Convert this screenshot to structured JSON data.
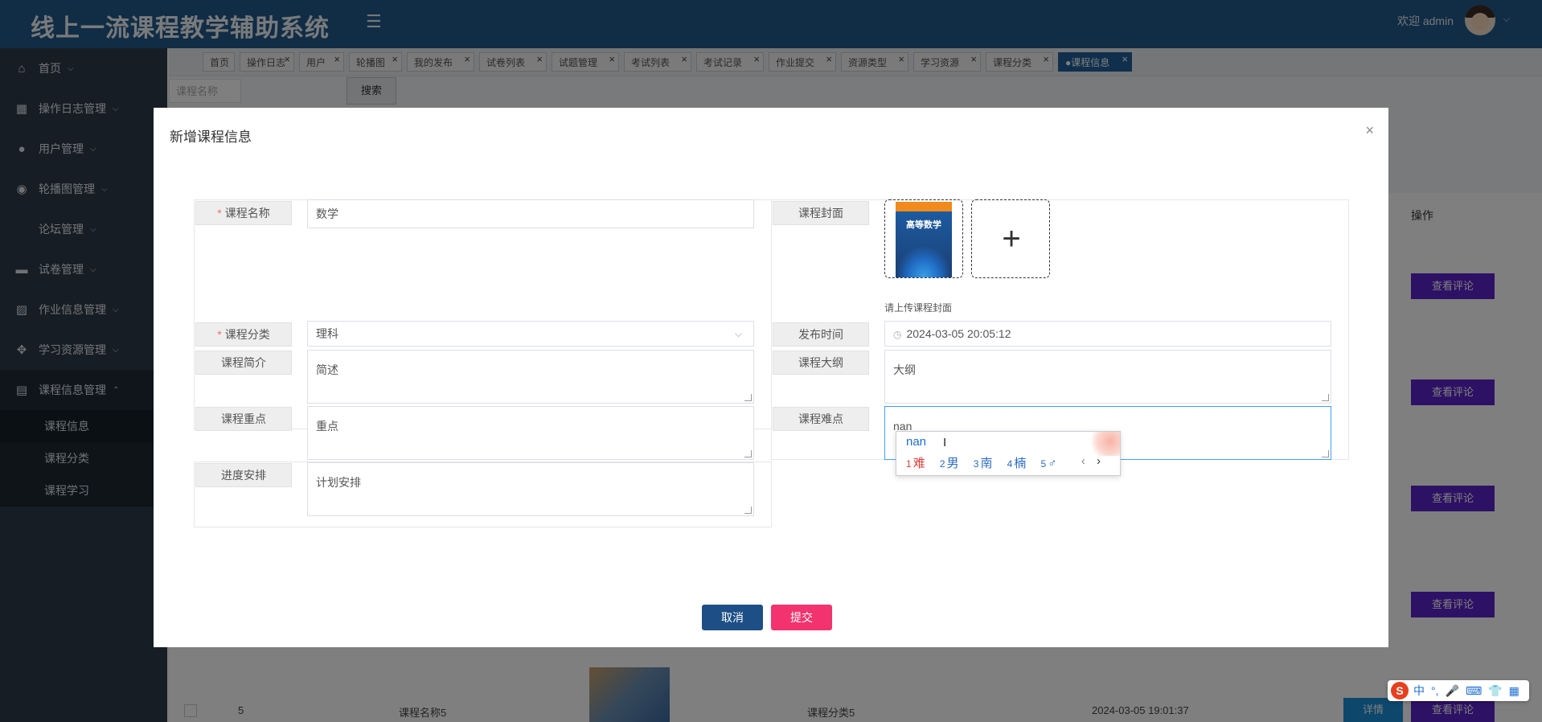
{
  "header": {
    "app_title": "线上一流课程教学辅助系统",
    "menu_toggle": "☰",
    "welcome": "欢迎 admin",
    "user_chevron": "⌵"
  },
  "sidebar": {
    "items": [
      {
        "label": "首页",
        "icon": "home-icon",
        "glyph": "⌂"
      },
      {
        "label": "操作日志管理",
        "icon": "grid-icon",
        "glyph": "▦"
      },
      {
        "label": "用户管理",
        "icon": "user-icon",
        "glyph": "●"
      },
      {
        "label": "轮播图管理",
        "icon": "carousel-icon",
        "glyph": "◉"
      },
      {
        "label": "论坛管理",
        "icon": "",
        "glyph": ""
      },
      {
        "label": "试卷管理",
        "icon": "paper-icon",
        "glyph": "▬"
      },
      {
        "label": "作业信息管理",
        "icon": "homework-icon",
        "glyph": "▨"
      },
      {
        "label": "学习资源管理",
        "icon": "resource-icon",
        "glyph": "✥"
      },
      {
        "label": "课程信息管理",
        "icon": "course-icon",
        "glyph": "▤"
      }
    ],
    "chevron_down": "⌵",
    "chevron_up": "⌃",
    "submenu": [
      "课程信息",
      "课程分类",
      "课程学习"
    ]
  },
  "tabs": [
    {
      "label": "首页"
    },
    {
      "label": "操作日志"
    },
    {
      "label": "用户"
    },
    {
      "label": "轮播图"
    },
    {
      "label": "我的发布"
    },
    {
      "label": "试卷列表"
    },
    {
      "label": "试题管理"
    },
    {
      "label": "考试列表"
    },
    {
      "label": "考试记录"
    },
    {
      "label": "作业提交"
    },
    {
      "label": "资源类型"
    },
    {
      "label": "学习资源"
    },
    {
      "label": "课程分类"
    },
    {
      "label": "●课程信息"
    }
  ],
  "tab_close": "×",
  "search": {
    "placeholder": "课程名称",
    "button": "搜索"
  },
  "background_table": {
    "action_header": "操作",
    "comment_button": "查看评论",
    "detail_button": "详情",
    "last_row": {
      "index": "5",
      "name": "课程名称5",
      "category": "课程分类5",
      "time": "2024-03-05 19:01:37"
    }
  },
  "dialog": {
    "title": "新增课程信息",
    "close": "×",
    "labels": {
      "name": "课程名称",
      "cover": "课程封面",
      "category": "课程分类",
      "publish_time": "发布时间",
      "intro": "课程简介",
      "outline": "课程大纲",
      "key_points": "课程重点",
      "difficulties": "课程难点",
      "schedule": "进度安排"
    },
    "required_mark": "*",
    "values": {
      "name": "数学",
      "category": "理科",
      "publish_time": "2024-03-05 20:05:12",
      "intro": "简述",
      "outline": "大纲",
      "key_points": "重点",
      "difficulties": "nan",
      "schedule": "计划安排"
    },
    "cover_book_title": "高等数学",
    "cover_hint": "请上传课程封面",
    "add_glyph": "+",
    "select_arrow": "⌵",
    "date_glyph": "◷",
    "cancel": "取消",
    "submit": "提交"
  },
  "ime": {
    "input": "nan",
    "candidates": [
      {
        "n": "1",
        "text": "难"
      },
      {
        "n": "2",
        "text": "男"
      },
      {
        "n": "3",
        "text": "南"
      },
      {
        "n": "4",
        "text": "楠"
      },
      {
        "n": "5",
        "text": "♂"
      }
    ],
    "prev": "‹",
    "next": "›",
    "ibeam": "I"
  },
  "ime_toolbar": {
    "logo": "S",
    "items": [
      "中",
      "°,",
      "🎤",
      "⌨",
      "👕",
      "▦"
    ]
  },
  "colors": {
    "header": "#235b8a",
    "sidebar": "#2f3b49",
    "accent_purple": "#5a22c8",
    "accent_blue": "#1a8ed6",
    "cancel": "#1d4f86",
    "submit": "#f2336f"
  }
}
